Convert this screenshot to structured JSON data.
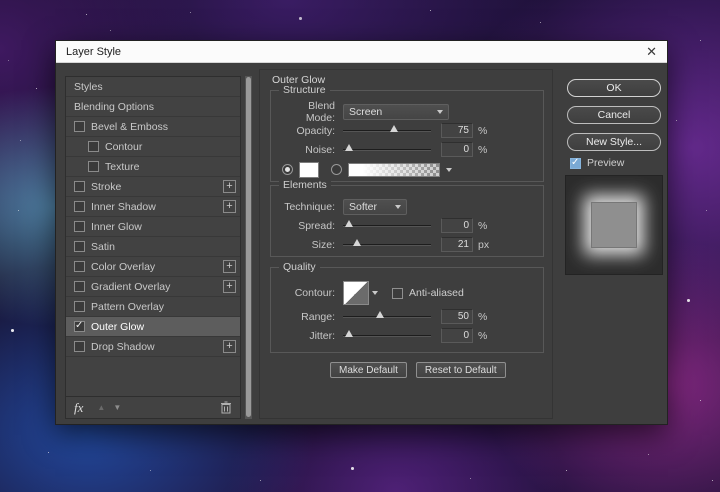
{
  "window": {
    "title": "Layer Style",
    "close_glyph": "✕"
  },
  "sidebar": {
    "plus_label": "+",
    "items": [
      {
        "label": "Styles"
      },
      {
        "label": "Blending Options"
      },
      {
        "label": "Bevel & Emboss",
        "checkbox": true
      },
      {
        "label": "Contour",
        "checkbox": true,
        "indent": true
      },
      {
        "label": "Texture",
        "checkbox": true,
        "indent": true
      },
      {
        "label": "Stroke",
        "checkbox": true,
        "plus": true
      },
      {
        "label": "Inner Shadow",
        "checkbox": true,
        "plus": true
      },
      {
        "label": "Inner Glow",
        "checkbox": true
      },
      {
        "label": "Satin",
        "checkbox": true
      },
      {
        "label": "Color Overlay",
        "checkbox": true,
        "plus": true
      },
      {
        "label": "Gradient Overlay",
        "checkbox": true,
        "plus": true
      },
      {
        "label": "Pattern Overlay",
        "checkbox": true
      },
      {
        "label": "Outer Glow",
        "checkbox": true,
        "checked": true,
        "selected": true
      },
      {
        "label": "Drop Shadow",
        "checkbox": true,
        "plus": true
      }
    ],
    "footer": {
      "fx": "fx",
      "up": "▲",
      "down": "▼"
    }
  },
  "panel": {
    "title": "Outer Glow",
    "structure": {
      "title": "Structure",
      "blend_mode_label": "Blend Mode:",
      "blend_mode_value": "Screen",
      "opacity_label": "Opacity:",
      "opacity_value": "75",
      "opacity_unit": "%",
      "noise_label": "Noise:",
      "noise_value": "0",
      "noise_unit": "%",
      "color_selected": true,
      "gradient_selected": false,
      "glow_color": "#ffffff"
    },
    "elements": {
      "title": "Elements",
      "technique_label": "Technique:",
      "technique_value": "Softer",
      "spread_label": "Spread:",
      "spread_value": "0",
      "spread_unit": "%",
      "size_label": "Size:",
      "size_value": "21",
      "size_unit": "px"
    },
    "quality": {
      "title": "Quality",
      "contour_label": "Contour:",
      "antialiased_label": "Anti-aliased",
      "antialiased_checked": false,
      "range_label": "Range:",
      "range_value": "50",
      "range_unit": "%",
      "jitter_label": "Jitter:",
      "jitter_value": "0",
      "jitter_unit": "%"
    },
    "footer_buttons": {
      "make_default": "Make Default",
      "reset_default": "Reset to Default"
    }
  },
  "actions": {
    "ok": "OK",
    "cancel": "Cancel",
    "new_style": "New Style...",
    "preview_label": "Preview",
    "preview_checked": true
  }
}
